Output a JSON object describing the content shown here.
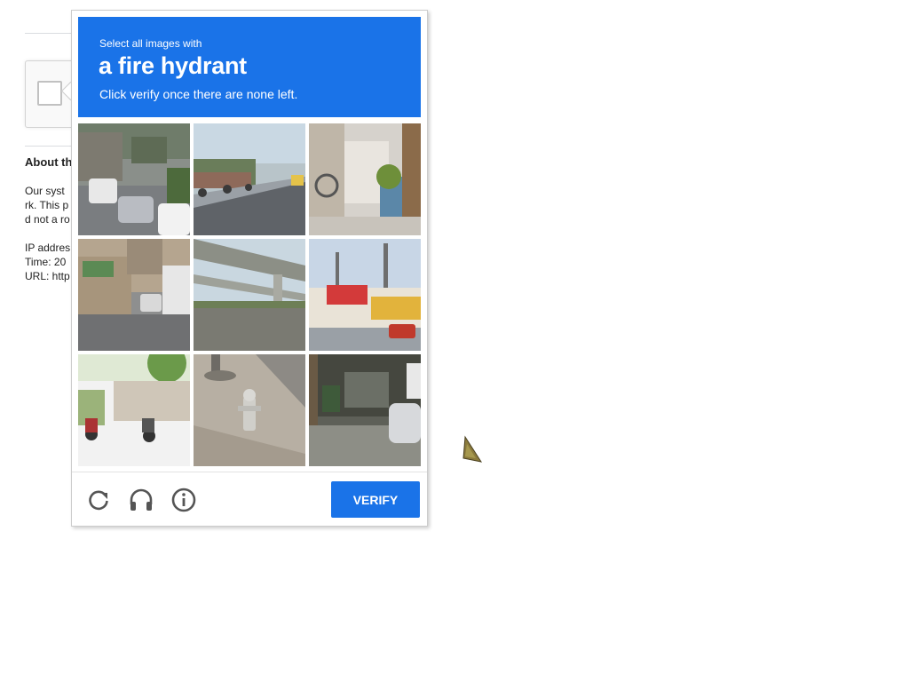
{
  "background_page": {
    "heading": "About th",
    "lines": [
      "Our syst",
      "rk. This p",
      "d not a ro",
      "IP addres",
      "Time: 20",
      "URL: http"
    ]
  },
  "challenge": {
    "instruction_small": "Select all images with",
    "target_object": "a fire hydrant",
    "instruction_hint": "Click verify once there are none left.",
    "grid": [
      {
        "id": 1,
        "scene": "street-with-cars"
      },
      {
        "id": 2,
        "scene": "road-with-motorbikes"
      },
      {
        "id": 3,
        "scene": "storefront-with-plants"
      },
      {
        "id": 4,
        "scene": "street-with-bus"
      },
      {
        "id": 5,
        "scene": "elevated-highway"
      },
      {
        "id": 6,
        "scene": "roadside-shops"
      },
      {
        "id": 7,
        "scene": "motorbikes-under-trees"
      },
      {
        "id": 8,
        "scene": "sidewalk-fire-hydrant"
      },
      {
        "id": 9,
        "scene": "parked-car-by-wall"
      }
    ],
    "footer": {
      "reload_icon": "reload-icon",
      "audio_icon": "headphones-icon",
      "info_icon": "info-icon",
      "verify_label": "Verify"
    },
    "colors": {
      "accent": "#1a73e8",
      "icon": "#555555"
    }
  }
}
